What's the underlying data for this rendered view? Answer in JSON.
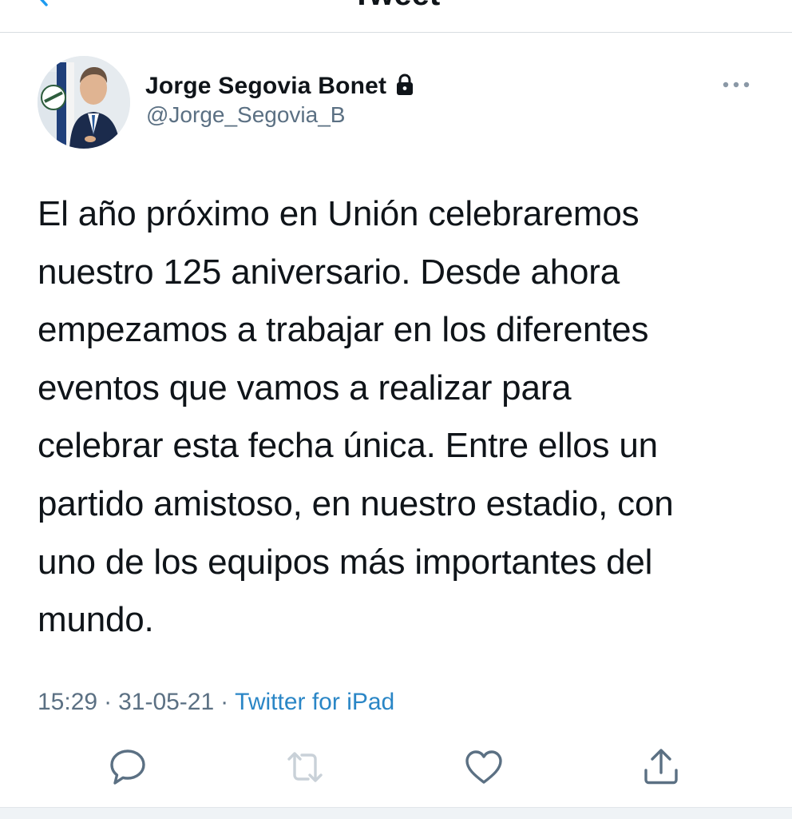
{
  "header": {
    "title": "Tweet"
  },
  "author": {
    "display_name": "Jorge Segovia Bonet",
    "handle": "@Jorge_Segovia_B",
    "protected": true
  },
  "tweet": {
    "text": "El año próximo en Unión celebraremos\nnuestro 125 aniversario. Desde ahora\nempezamos a trabajar en los diferentes\neventos que vamos a realizar para\ncelebrar esta fecha única. Entre ellos un\npartido amistoso, en nuestro estadio, con\nuno de los equipos más importantes del\nmundo.",
    "time": "15:29",
    "date": "31-05-21",
    "separator": "·",
    "source": "Twitter for iPad"
  },
  "icons": {
    "back": "chevron-left-icon",
    "lock": "lock-icon",
    "more": "more-horizontal-icon",
    "reply": "reply-icon",
    "retweet": "retweet-icon",
    "like": "heart-icon",
    "share": "share-icon"
  },
  "colors": {
    "text": "#0f1419",
    "secondary": "#5b7083",
    "link": "#2a86c6",
    "icon": "#5b7083",
    "divider": "#d8dde1"
  }
}
